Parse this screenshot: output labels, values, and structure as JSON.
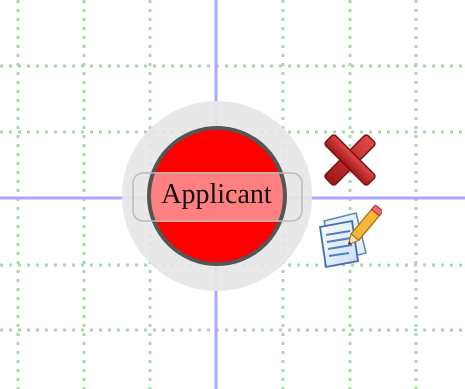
{
  "node": {
    "label": "Applicant",
    "fill_color": "#ff0000",
    "label_band_color": "#ff8080",
    "border_color": "#555555",
    "halo_color": "#e6e6e6",
    "shape": "circle"
  },
  "actions": [
    {
      "name": "delete",
      "icon": "red-x-icon",
      "color": "#c62828"
    },
    {
      "name": "edit",
      "icon": "document-pencil-icon",
      "color": "#3f7fd0"
    }
  ],
  "canvas": {
    "grid_color": "#a8d8a8",
    "axis_color": "#a8a8ff",
    "background": "#ffffff"
  }
}
